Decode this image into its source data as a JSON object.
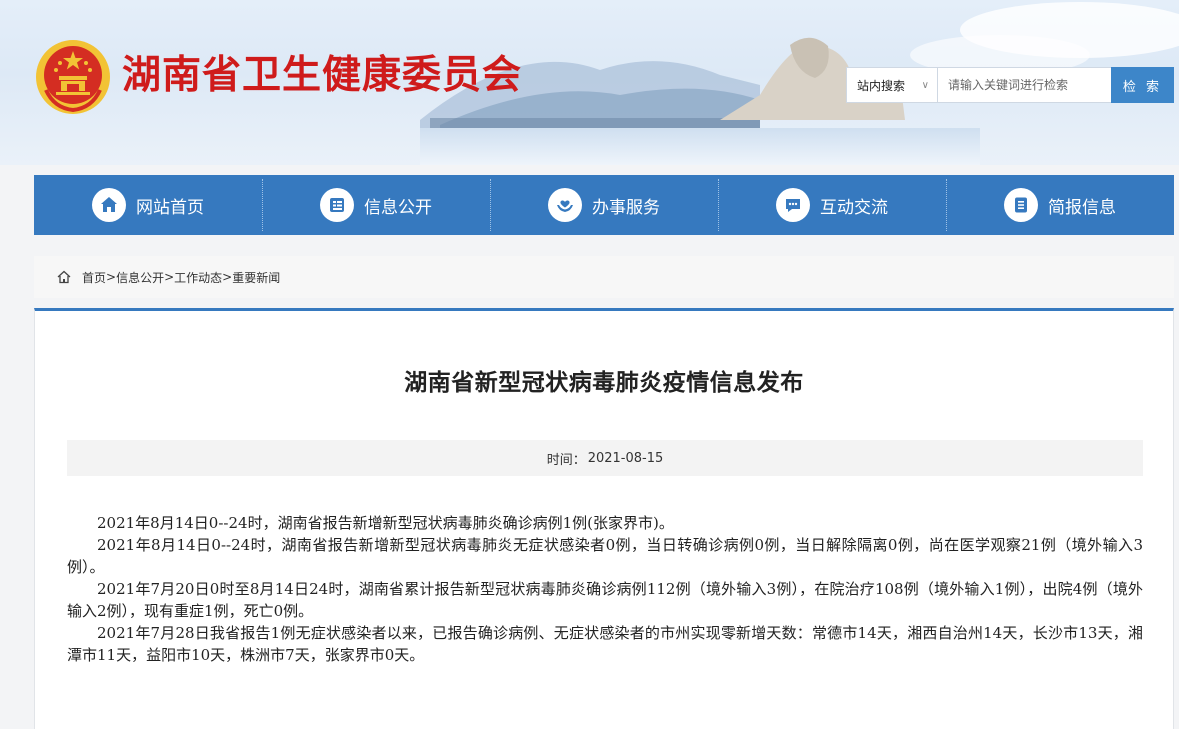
{
  "header": {
    "site_title": "湖南省卫生健康委员会",
    "emblem_icon": "national-emblem-icon",
    "colors": {
      "title": "#cf1b1b",
      "emblem_red": "#d42d22",
      "emblem_gold": "#f2c335"
    }
  },
  "search": {
    "scope_label": "站内搜索",
    "placeholder": "请输入关键词进行检索",
    "button_label": "检 索"
  },
  "nav": {
    "color": "#3679bf",
    "items": [
      {
        "label": "网站首页",
        "icon": "home-icon"
      },
      {
        "label": "信息公开",
        "icon": "document-list-icon"
      },
      {
        "label": "办事服务",
        "icon": "hands-heart-icon"
      },
      {
        "label": "互动交流",
        "icon": "chat-bubble-icon"
      },
      {
        "label": "简报信息",
        "icon": "report-icon"
      }
    ]
  },
  "breadcrumb": {
    "items": [
      "首页",
      "信息公开",
      "工作动态",
      "重要新闻"
    ],
    "separator": ">"
  },
  "article": {
    "title": "湖南省新型冠状病毒肺炎疫情信息发布",
    "meta_label": "时间：",
    "date": "2021-08-15",
    "paragraphs": [
      "2021年8月14日0--24时，湖南省报告新增新型冠状病毒肺炎确诊病例1例(张家界市)。",
      "2021年8月14日0--24时，湖南省报告新增新型冠状病毒肺炎无症状感染者0例，当日转确诊病例0例，当日解除隔离0例，尚在医学观察21例（境外输入3例）。",
      "2021年7月20日0时至8月14日24时，湖南省累计报告新型冠状病毒肺炎确诊病例112例（境外输入3例），在院治疗108例（境外输入1例），出院4例（境外输入2例），现有重症1例，死亡0例。",
      "2021年7月28日我省报告1例无症状感染者以来，已报告确诊病例、无症状感染者的市州实现零新增天数：常德市14天，湘西自治州14天，长沙市13天，湘潭市11天，益阳市10天，株洲市7天，张家界市0天。"
    ]
  }
}
